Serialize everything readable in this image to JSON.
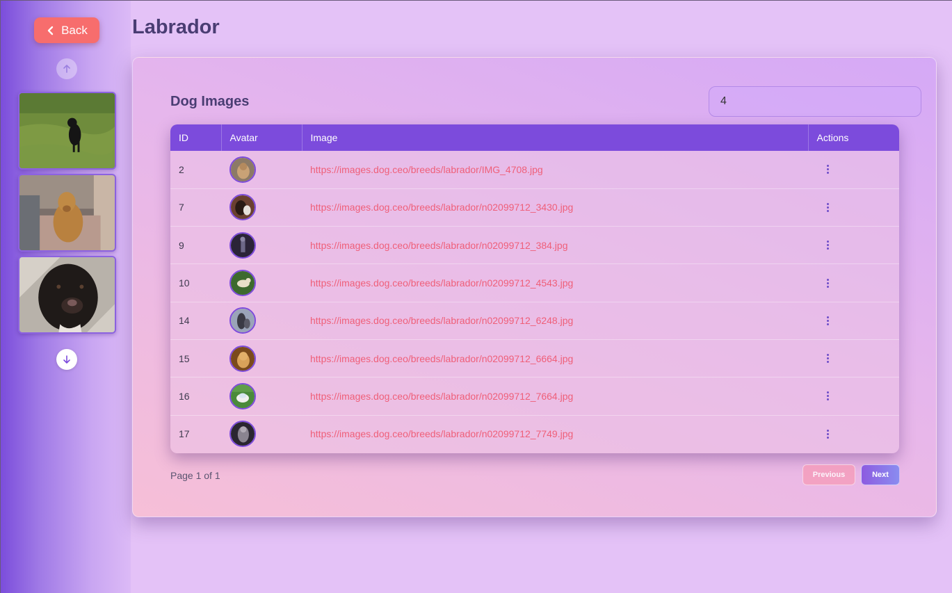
{
  "nav": {
    "back_label": "Back",
    "scroll_up_icon": "arrow-up-icon",
    "scroll_down_icon": "arrow-down-icon",
    "thumbnails": [
      {
        "subject": "black labrador on grass"
      },
      {
        "subject": "yellow labrador on couch"
      },
      {
        "subject": "chocolate labrador close-up"
      }
    ]
  },
  "page": {
    "title": "Labrador"
  },
  "card": {
    "title": "Dog Images",
    "search_value": "4"
  },
  "table": {
    "columns": [
      "ID",
      "Avatar",
      "Image",
      "Actions"
    ],
    "rows": [
      {
        "id": "2",
        "url": "https://images.dog.ceo/breeds/labrador/IMG_4708.jpg"
      },
      {
        "id": "7",
        "url": "https://images.dog.ceo/breeds/labrador/n02099712_3430.jpg"
      },
      {
        "id": "9",
        "url": "https://images.dog.ceo/breeds/labrador/n02099712_384.jpg"
      },
      {
        "id": "10",
        "url": "https://images.dog.ceo/breeds/labrador/n02099712_4543.jpg"
      },
      {
        "id": "14",
        "url": "https://images.dog.ceo/breeds/labrador/n02099712_6248.jpg"
      },
      {
        "id": "15",
        "url": "https://images.dog.ceo/breeds/labrador/n02099712_6664.jpg"
      },
      {
        "id": "16",
        "url": "https://images.dog.ceo/breeds/labrador/n02099712_7664.jpg"
      },
      {
        "id": "17",
        "url": "https://images.dog.ceo/breeds/labrador/n02099712_7749.jpg"
      }
    ],
    "action_icon": "more-vertical-icon"
  },
  "pagination": {
    "info": "Page 1 of 1",
    "previous_label": "Previous",
    "next_label": "Next"
  },
  "colors": {
    "accent": "#7c4bdc",
    "link": "#ef5f79",
    "back_button": "#f76d6d"
  }
}
